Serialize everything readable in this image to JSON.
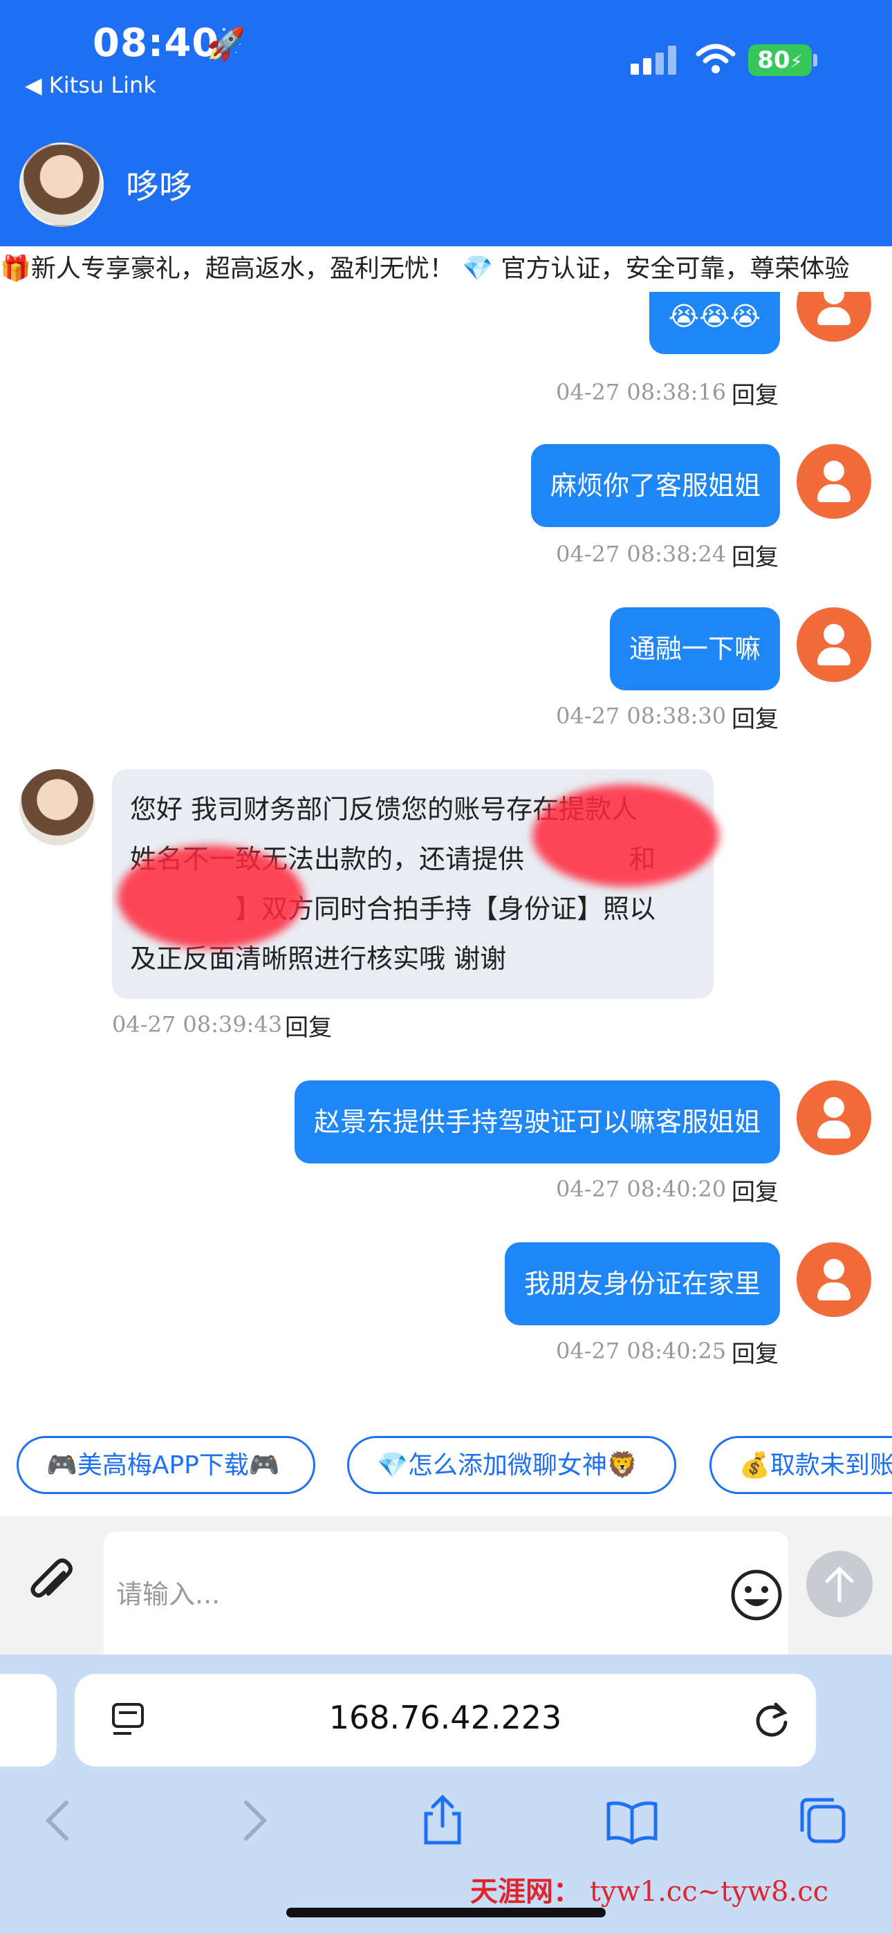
{
  "status": {
    "time": "08:40",
    "back_app": "◀ Kitsu Link",
    "battery": "80"
  },
  "header": {
    "contact_name": "哆哆"
  },
  "marquee": {
    "text": "🎁新人专享豪礼，超高返水，盈利无忧！ 💎 官方认证，安全可靠，尊荣体验"
  },
  "messages": [
    {
      "from": "me",
      "text": "😭😭😭",
      "time": "04-27 08:38:16",
      "reply": "回复"
    },
    {
      "from": "me",
      "text": "麻烦你了客服姐姐",
      "time": "04-27 08:38:24",
      "reply": "回复"
    },
    {
      "from": "me",
      "text": "通融一下嘛",
      "time": "04-27 08:38:30",
      "reply": "回复"
    },
    {
      "from": "them",
      "lines": [
        "您好 我司财务部门反馈您的账号存在提款人",
        "姓名不一致无法出款的，还请提供　　　　和",
        "　　　　】双方同时合拍手持【身份证】照以",
        "及正反面清晰照进行核实哦 谢谢"
      ],
      "time": "04-27 08:39:43",
      "reply": "回复"
    },
    {
      "from": "me",
      "text": "赵景东提供手持驾驶证可以嘛客服姐姐",
      "time": "04-27 08:40:20",
      "reply": "回复"
    },
    {
      "from": "me",
      "text": "我朋友身份证在家里",
      "time": "04-27 08:40:25",
      "reply": "回复"
    }
  ],
  "quick_replies": [
    "🎮美高梅APP下载🎮",
    "💎怎么添加微聊女神🦁",
    "💰取款未到账"
  ],
  "composer": {
    "placeholder": "请输入..."
  },
  "browser": {
    "url": "168.76.42.223"
  },
  "watermark": {
    "name": "天涯网：",
    "url": "tyw1.cc~tyw8.cc"
  },
  "colors": {
    "brand_blue": "#1f6ff2",
    "bubble_me": "#1f86f5",
    "avatar_orange": "#f26b3a"
  }
}
